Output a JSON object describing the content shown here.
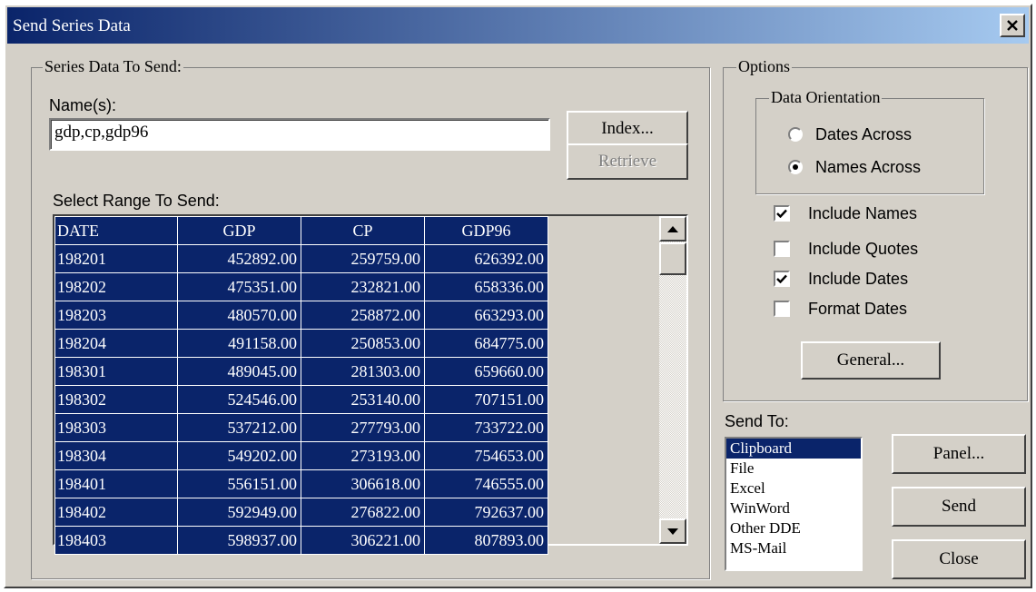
{
  "window": {
    "title": "Send Series Data",
    "close_glyph": "×"
  },
  "series_group": {
    "legend": "Series Data To Send:",
    "names_label": "Name(s):",
    "names_value": "gdp,cp,gdp96",
    "range_label": "Select Range To Send:"
  },
  "buttons": {
    "index": "Index...",
    "retrieve": "Retrieve",
    "general": "General...",
    "panel": "Panel...",
    "send": "Send",
    "close": "Close"
  },
  "grid": {
    "columns": [
      "DATE",
      "GDP",
      "CP",
      "GDP96"
    ],
    "rows": [
      [
        "198201",
        "452892.00",
        "259759.00",
        "626392.00"
      ],
      [
        "198202",
        "475351.00",
        "232821.00",
        "658336.00"
      ],
      [
        "198203",
        "480570.00",
        "258872.00",
        "663293.00"
      ],
      [
        "198204",
        "491158.00",
        "250853.00",
        "684775.00"
      ],
      [
        "198301",
        "489045.00",
        "281303.00",
        "659660.00"
      ],
      [
        "198302",
        "524546.00",
        "253140.00",
        "707151.00"
      ],
      [
        "198303",
        "537212.00",
        "277793.00",
        "733722.00"
      ],
      [
        "198304",
        "549202.00",
        "273193.00",
        "754653.00"
      ],
      [
        "198401",
        "556151.00",
        "306618.00",
        "746555.00"
      ],
      [
        "198402",
        "592949.00",
        "276822.00",
        "792637.00"
      ],
      [
        "198403",
        "598937.00",
        "306221.00",
        "807893.00"
      ]
    ]
  },
  "options": {
    "legend": "Options",
    "orientation_legend": "Data Orientation",
    "dates_across": "Dates Across",
    "names_across": "Names Across",
    "selected_orientation": "names_across",
    "include_names": "Include Names",
    "include_quotes": "Include Quotes",
    "include_dates": "Include Dates",
    "format_dates": "Format Dates",
    "checked": {
      "include_names": true,
      "include_quotes": false,
      "include_dates": true,
      "format_dates": false
    }
  },
  "send_to": {
    "label": "Send To:",
    "items": [
      "Clipboard",
      "File",
      "Excel",
      "WinWord",
      "Other DDE",
      "MS-Mail"
    ],
    "selected": "Clipboard"
  },
  "icons": {
    "close": "close-icon",
    "scroll_up": "arrow-up-icon",
    "scroll_down": "arrow-down-icon",
    "check": "checkmark-icon"
  },
  "colors": {
    "titlebar": "#0a246a",
    "selection": "#0a246a",
    "face": "#d4d0c8"
  }
}
